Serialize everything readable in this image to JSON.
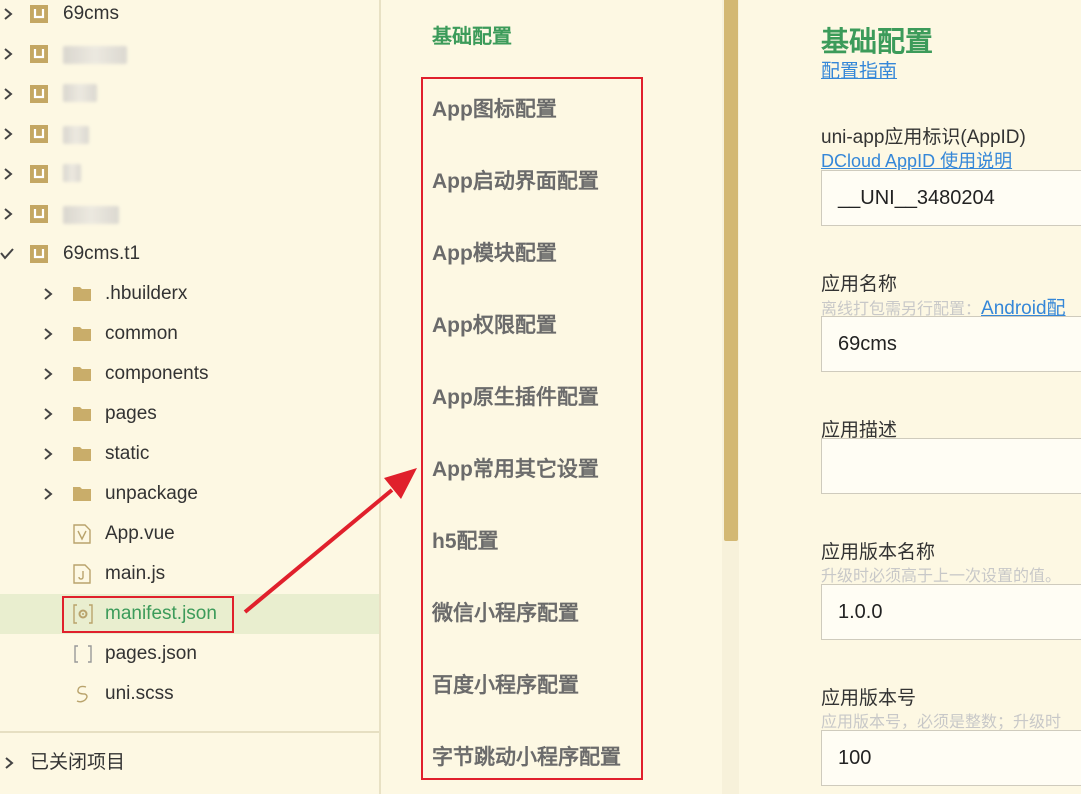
{
  "tree": {
    "projects": [
      {
        "label": "69cms",
        "blurred": false
      },
      {
        "label": "",
        "blurred": true
      },
      {
        "label": "",
        "blurred": true
      },
      {
        "label": "",
        "blurred": true
      },
      {
        "label": "",
        "blurred": true
      },
      {
        "label": "",
        "blurred": true
      }
    ],
    "open_project": "69cms.t1",
    "folders": [
      ".hbuilderx",
      "common",
      "components",
      "pages",
      "static",
      "unpackage"
    ],
    "files": [
      {
        "label": "App.vue",
        "icon": "vue-file-icon"
      },
      {
        "label": "main.js",
        "icon": "js-file-icon"
      },
      {
        "label": "manifest.json",
        "icon": "manifest-file-icon",
        "selected": true
      },
      {
        "label": "pages.json",
        "icon": "json-file-icon"
      },
      {
        "label": "uni.scss",
        "icon": "scss-file-icon"
      }
    ],
    "closed_projects": "已关闭项目"
  },
  "nav": {
    "active": "基础配置",
    "items": [
      "App图标配置",
      "App启动界面配置",
      "App模块配置",
      "App权限配置",
      "App原生插件配置",
      "App常用其它设置",
      "h5配置",
      "微信小程序配置",
      "百度小程序配置",
      "字节跳动小程序配置"
    ]
  },
  "form": {
    "title": "基础配置",
    "guide_link": "配置指南",
    "appid_label": "uni-app应用标识(AppID)",
    "appid_link": "DCloud AppID 使用说明",
    "appid_value": "__UNI__3480204",
    "name_label": "应用名称",
    "name_hint": "离线打包需另行配置：",
    "name_hint_link": "Android配",
    "name_value": "69cms",
    "desc_label": "应用描述",
    "desc_value": "",
    "version_name_label": "应用版本名称",
    "version_name_hint": "升级时必须高于上一次设置的值。",
    "version_name_value": "1.0.0",
    "version_code_label": "应用版本号",
    "version_code_hint": "应用版本号，必须是整数；升级时",
    "version_code_value": "100"
  },
  "colors": {
    "accent_green": "#3c9b5a",
    "link_blue": "#3587d8",
    "annotation_red": "#e0202c",
    "project_icon": "#c4a763"
  }
}
